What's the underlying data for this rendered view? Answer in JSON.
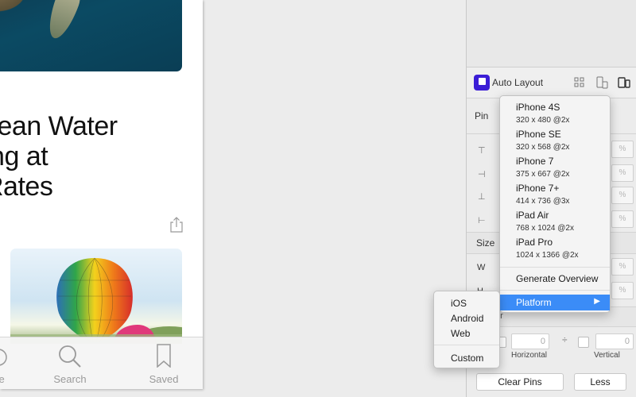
{
  "article": {
    "headline_lines": [
      "cean Water",
      "ing at",
      "Rates"
    ]
  },
  "tabbar": {
    "items": [
      {
        "label": "re",
        "icon": "star-icon"
      },
      {
        "label": "Search",
        "icon": "search-icon"
      },
      {
        "label": "Saved",
        "icon": "bookmark-icon"
      }
    ]
  },
  "inspector": {
    "plugin_title": "Auto Layout",
    "pin_label": "Pin",
    "size_label": "Size",
    "width_label": "W",
    "height_label": "H",
    "center_label": "er",
    "percent": "%",
    "horizontal_value": "0",
    "vertical_value": "0",
    "horizontal_label": "Horizontal",
    "vertical_label": "Vertical",
    "clear_pins_label": "Clear Pins",
    "less_label": "Less"
  },
  "device_menu": {
    "devices": [
      {
        "name": "iPhone 4S",
        "resolution": "320 x 480 @2x"
      },
      {
        "name": "iPhone SE",
        "resolution": "320 x 568 @2x"
      },
      {
        "name": "iPhone 7",
        "resolution": "375 x 667 @2x"
      },
      {
        "name": "iPhone 7+",
        "resolution": "414 x 736 @3x"
      },
      {
        "name": "iPad Air",
        "resolution": "768 x 1024 @2x"
      },
      {
        "name": "iPad Pro",
        "resolution": "1024 x 1366 @2x"
      }
    ],
    "generate_overview": "Generate Overview",
    "platform": "Platform",
    "platform_arrow": "▶"
  },
  "platform_menu": {
    "items": [
      "iOS",
      "Android",
      "Web"
    ],
    "custom": "Custom"
  },
  "colors": {
    "accent": "#3b8cf7",
    "plugin_logo": "#3b1dd6"
  }
}
